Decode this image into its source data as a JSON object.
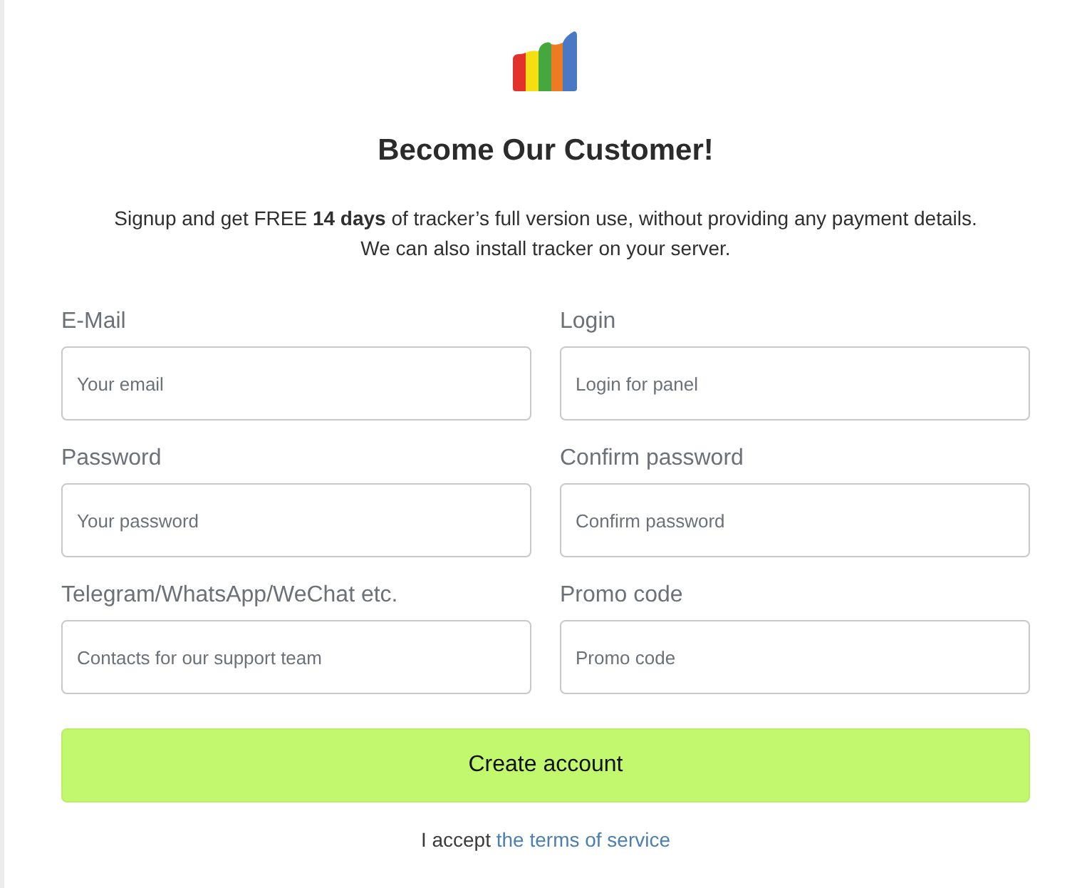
{
  "title": "Become Our Customer!",
  "intro": [
    "Signup and get FREE **14 days** of tracker’s full version use, without providing any payment details.",
    "We can also install tracker on your server."
  ],
  "fields": [
    {
      "label": "E-Mail",
      "placeholder": "Your email"
    },
    {
      "label": "Login",
      "placeholder": "Login for panel"
    },
    {
      "label": "Password",
      "placeholder": "Your password"
    },
    {
      "label": "Confirm password",
      "placeholder": "Confirm password"
    },
    {
      "label": "Telegram/WhatsApp/WeChat etc.",
      "placeholder": "Contacts for our support team"
    },
    {
      "label": "Promo code",
      "placeholder": "Promo code"
    }
  ],
  "submit_button": "Create account",
  "terms": {
    "text": "I accept",
    "link": "the terms of service"
  }
}
